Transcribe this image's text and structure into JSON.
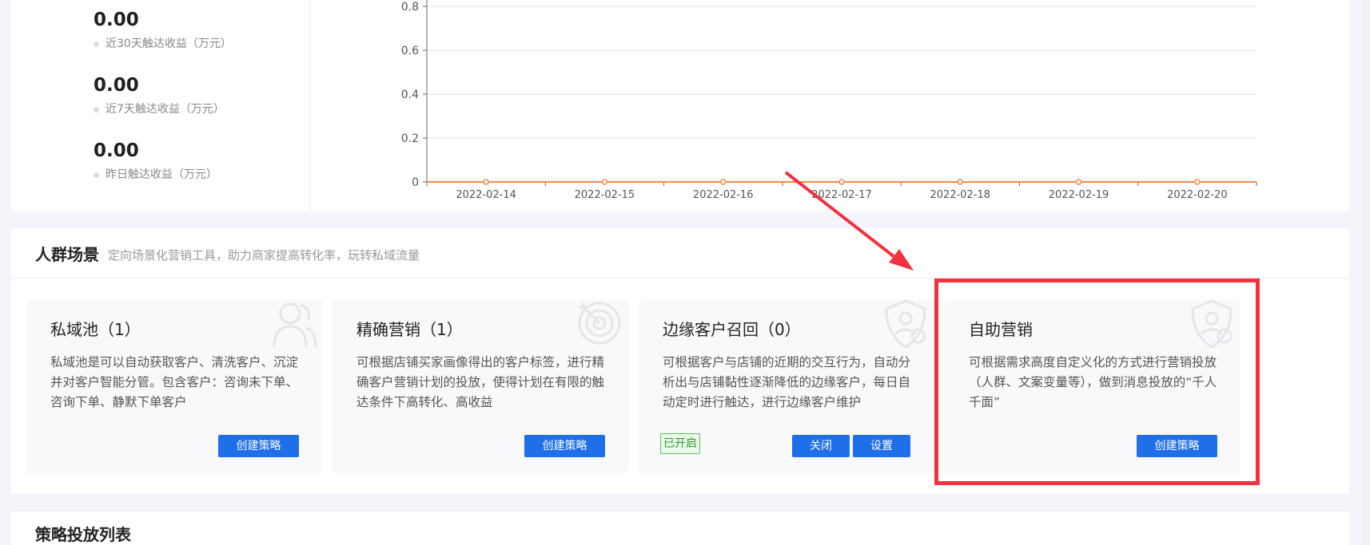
{
  "stats": [
    {
      "value": "0.00",
      "label": "近30天触达收益（万元）"
    },
    {
      "value": "0.00",
      "label": "近7天触达收益（万元）"
    },
    {
      "value": "0.00",
      "label": "昨日触达收益（万元）"
    }
  ],
  "chart_data": {
    "type": "line",
    "x": [
      "2022-02-14",
      "2022-02-15",
      "2022-02-16",
      "2022-02-17",
      "2022-02-18",
      "2022-02-19",
      "2022-02-20"
    ],
    "y_ticks": [
      "0",
      "0.2",
      "0.4",
      "0.6",
      "0.8"
    ],
    "ylim": [
      0,
      0.8
    ],
    "series": [
      {
        "values": [
          0,
          0,
          0,
          0,
          0,
          0,
          0
        ],
        "color": "#f5894a"
      }
    ],
    "grid": true
  },
  "scene": {
    "title": "人群场景",
    "subtitle": "定向场景化营销工具，助力商家提高转化率，玩转私域流量",
    "cards": [
      {
        "title": "私域池（1）",
        "desc": "私域池是可以自动获取客户、清洗客户、沉淀并对客户智能分管。包含客户：咨询未下单、咨询下单、静默下单客户",
        "button": "创建策略",
        "icon": "users-icon"
      },
      {
        "title": "精确营销（1）",
        "desc": "可根据店铺买家画像得出的客户标签，进行精确客户营销计划的投放，使得计划在有限的触达条件下高转化、高收益",
        "button": "创建策略",
        "icon": "target-icon"
      },
      {
        "title": "边缘客户召回（0）",
        "desc": "可根据客户与店铺的近期的交互行为，自动分析出与店铺黏性逐渐降低的边缘客户，每日自动定时进行触达，进行边缘客户维护",
        "badge": "已开启",
        "close_button": "关闭",
        "settings_button": "设置",
        "icon": "shield-user-icon"
      },
      {
        "title": "自助营销",
        "desc": "可根据需求高度自定义化的方式进行营销投放（人群、文案变量等），做到消息投放的“千人千面”",
        "button": "创建策略",
        "icon": "shield-user-icon"
      }
    ]
  },
  "list": {
    "title": "策略投放列表"
  },
  "colors": {
    "accent": "#1e6fe8",
    "highlight": "#ef3340",
    "line": "#f5894a",
    "success": "#2f9a2f"
  }
}
